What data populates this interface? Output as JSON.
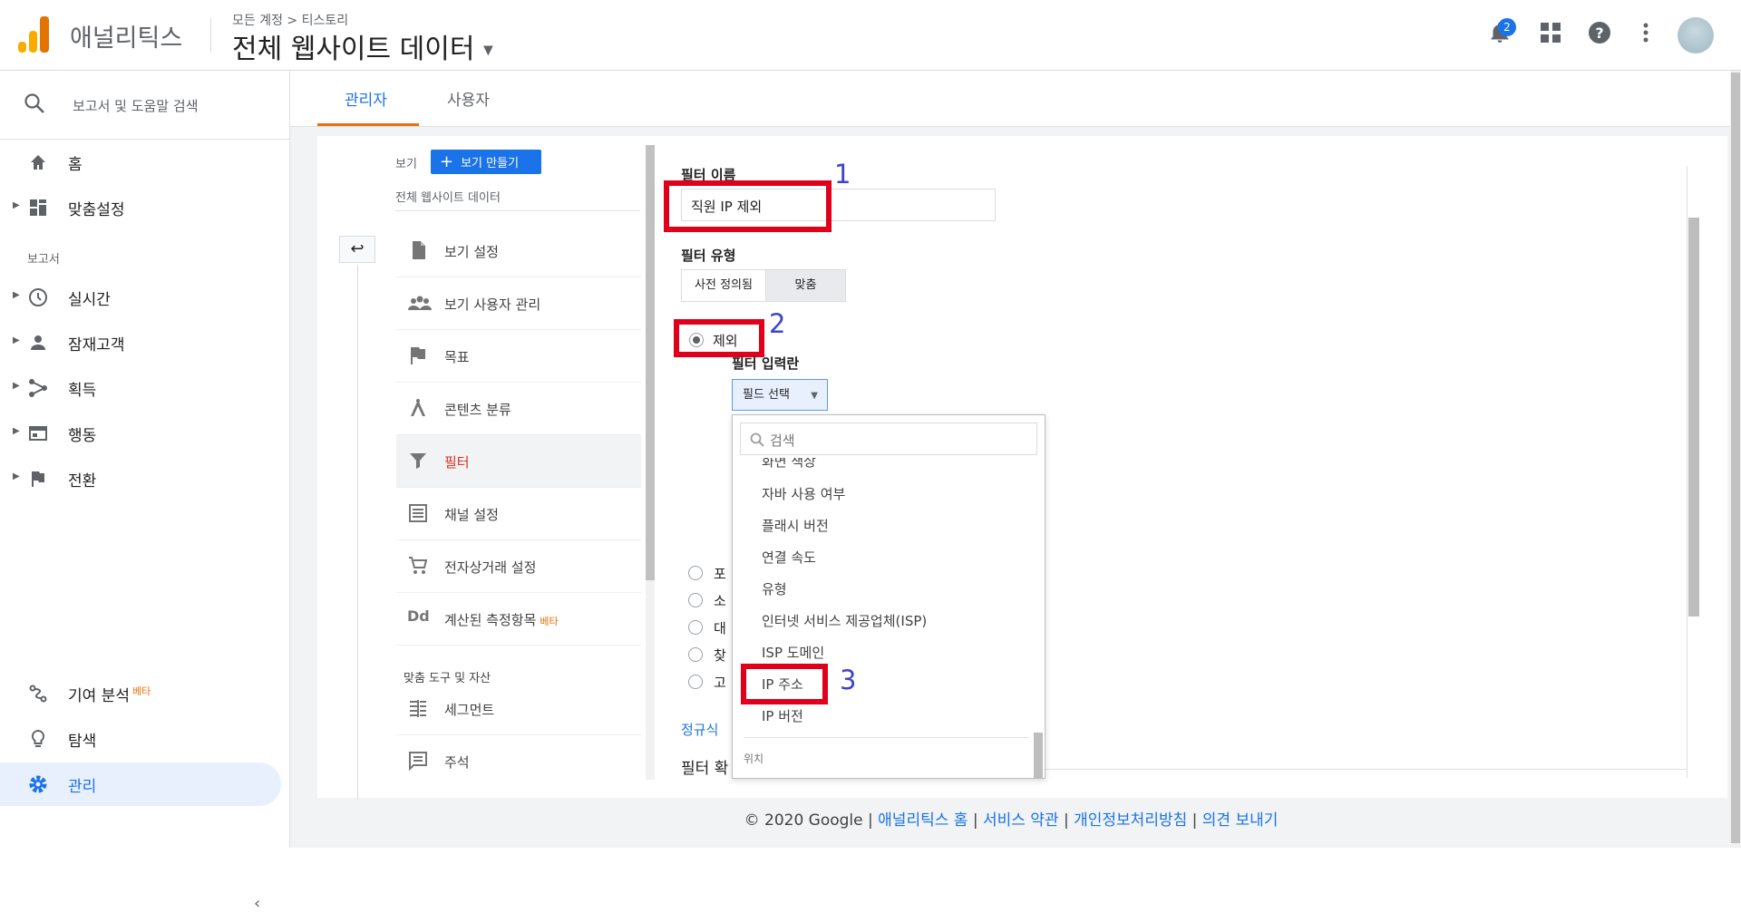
{
  "header": {
    "app_name": "애널리틱스",
    "breadcrumb": "모든 계정 > 티스토리",
    "account_view": "전체 웹사이트 데이터",
    "notification_count": "2"
  },
  "sidebar": {
    "search_placeholder": "보고서 및 도움말 검색",
    "items": [
      {
        "label": "홈",
        "icon": "home-icon"
      },
      {
        "label": "맞춤설정",
        "icon": "dashboard-icon"
      },
      {
        "label": "실시간",
        "icon": "clock-icon"
      },
      {
        "label": "잠재고객",
        "icon": "person-icon"
      },
      {
        "label": "획득",
        "icon": "acquisition-icon"
      },
      {
        "label": "행동",
        "icon": "behavior-icon"
      },
      {
        "label": "전환",
        "icon": "flag-icon"
      }
    ],
    "section_reports": "보고서",
    "bottom_items": [
      {
        "label": "기여 분석",
        "badge": "베타",
        "icon": "attribution-icon"
      },
      {
        "label": "탐색",
        "icon": "lightbulb-icon"
      },
      {
        "label": "관리",
        "icon": "gear-icon"
      }
    ]
  },
  "tabs": [
    "관리자",
    "사용자"
  ],
  "view_panel": {
    "view_label": "보기",
    "create_button": "보기 만들기",
    "view_name": "전체 웹사이트 데이터",
    "menu": [
      {
        "label": "보기 설정",
        "icon": "document-icon"
      },
      {
        "label": "보기 사용자 관리",
        "icon": "users-icon"
      },
      {
        "label": "목표",
        "icon": "flag-icon"
      },
      {
        "label": "콘텐츠 분류",
        "icon": "content-icon"
      },
      {
        "label": "필터",
        "icon": "filter-icon"
      },
      {
        "label": "채널 설정",
        "icon": "channel-icon"
      },
      {
        "label": "전자상거래 설정",
        "icon": "cart-icon"
      },
      {
        "label": "계산된 측정항목",
        "badge": "베타",
        "icon": "dd-icon"
      }
    ],
    "tools_header": "맞춤 도구 및 자산",
    "tools": [
      {
        "label": "세그먼트",
        "icon": "segment-icon"
      },
      {
        "label": "주석",
        "icon": "annotation-icon"
      }
    ]
  },
  "filter_form": {
    "name_label": "필터 이름",
    "name_value": "직원 IP 제외",
    "type_label": "필터 유형",
    "type_predefined": "사전 정의됨",
    "type_custom": "맞춤",
    "exclude_label": "제외",
    "filter_field_label": "필터 입력란",
    "field_select": "필드 선택",
    "other_radios": [
      "포",
      "소",
      "대",
      "찾",
      "고"
    ],
    "regex_link": "정규식",
    "transform_label": "필터 확",
    "annotations": [
      "1",
      "2",
      "3"
    ]
  },
  "dropdown": {
    "search_placeholder": "검색",
    "items": [
      "화면 색상",
      "자바 사용 여부",
      "플래시 버전",
      "연결 속도",
      "유형",
      "인터넷 서비스 제공업체(ISP)",
      "ISP 도메인",
      "IP 주소",
      "IP 버전"
    ],
    "section": "위치"
  },
  "footer": {
    "copyright": "© 2020 Google",
    "links": [
      "애널리틱스 홈",
      "서비스 약관",
      "개인정보처리방침",
      "의견 보내기"
    ]
  }
}
